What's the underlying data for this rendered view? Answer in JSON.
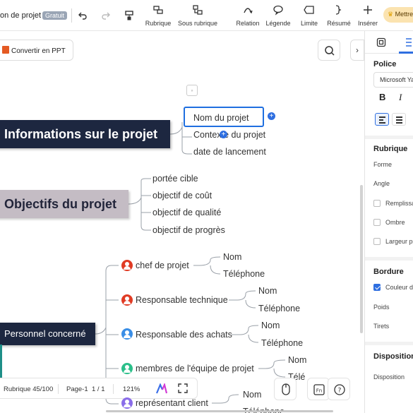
{
  "toolbar": {
    "doc_title": "on de projet",
    "badge": "Gratuit",
    "buttons": {
      "rubrique": "Rubrique",
      "sous_rubrique": "Sous rubrique",
      "relation": "Relation",
      "legende": "Légende",
      "limite": "Limite",
      "resume": "Résumé",
      "inserer": "Insérer"
    },
    "upgrade_label": "Mettre"
  },
  "canvas": {
    "convert_button": "Convertir en PPT",
    "topics": {
      "info": {
        "label": "Informations sur le projet",
        "children": [
          "Nom du projet",
          "Contexte du projet",
          "date de lancement"
        ]
      },
      "objectifs": {
        "label": "Objectifs du projet",
        "children": [
          "portée cible",
          "objectif de coût",
          "objectif de qualité",
          "objectif de progrès"
        ]
      },
      "personnel": {
        "label": "Personnel concerné",
        "roles": [
          {
            "label": "chef de projet",
            "color": "#e03b24",
            "fields": [
              "Nom",
              "Téléphone"
            ]
          },
          {
            "label": "Responsable technique",
            "color": "#e03b24",
            "fields": [
              "Nom",
              "Téléphone"
            ]
          },
          {
            "label": "Responsable des achats",
            "color": "#3a8ee6",
            "fields": [
              "Nom",
              "Téléphone"
            ]
          },
          {
            "label": "membres de l'équipe de projet",
            "color": "#2bbf8a",
            "fields": [
              "Nom",
              "Télé"
            ]
          },
          {
            "label": "représentant client",
            "color": "#8a6de9",
            "fields": [
              "Nom",
              "Téléphone"
            ]
          }
        ]
      }
    }
  },
  "statusbar": {
    "rubrique_count": "Rubrique 45/100",
    "page": "Page-1",
    "page_of": "1 / 1",
    "zoom": "121%"
  },
  "panel": {
    "police_title": "Police",
    "font_name": "Microsoft Ya",
    "bold": "B",
    "italic": "I",
    "rubrique_title": "Rubrique",
    "forme": "Forme",
    "angle": "Angle",
    "remplissage": "Remplissa",
    "ombre": "Ombre",
    "largeur": "Largeur po",
    "bordure_title": "Bordure",
    "couleur": "Couleur d",
    "poids": "Poids",
    "tirets": "Tirets",
    "disposition_title": "Disposition",
    "disposition": "Disposition"
  },
  "colors": {
    "accent": "#2f6fe0",
    "topic_dark": "#1d2740",
    "topic_light": "#c4bcc4"
  }
}
